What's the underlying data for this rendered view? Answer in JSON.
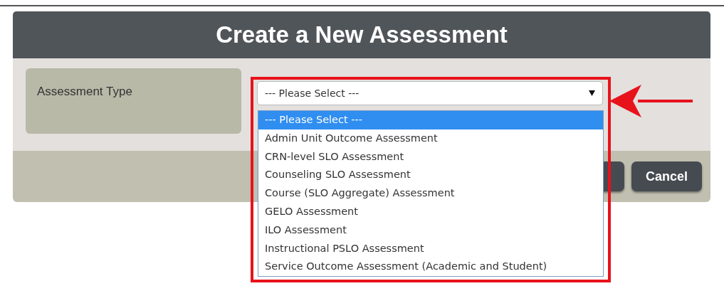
{
  "dialog": {
    "title": "Create a New Assessment"
  },
  "field": {
    "label": "Assessment Type",
    "value": "--- Please Select ---",
    "expanded": true,
    "options": [
      {
        "label": "--- Please Select ---",
        "selected": true
      },
      {
        "label": "Admin Unit Outcome Assessment",
        "selected": false
      },
      {
        "label": "CRN-level SLO Assessment",
        "selected": false
      },
      {
        "label": "Counseling SLO Assessment",
        "selected": false
      },
      {
        "label": "Course (SLO Aggregate) Assessment",
        "selected": false
      },
      {
        "label": "GELO Assessment",
        "selected": false
      },
      {
        "label": "ILO Assessment",
        "selected": false
      },
      {
        "label": "Instructional PSLO Assessment",
        "selected": false
      },
      {
        "label": "Service Outcome Assessment (Academic and Student)",
        "selected": false
      }
    ]
  },
  "buttons": [
    {
      "kind": "covered"
    },
    {
      "kind": "labeled",
      "label": "Cancel"
    }
  ]
}
